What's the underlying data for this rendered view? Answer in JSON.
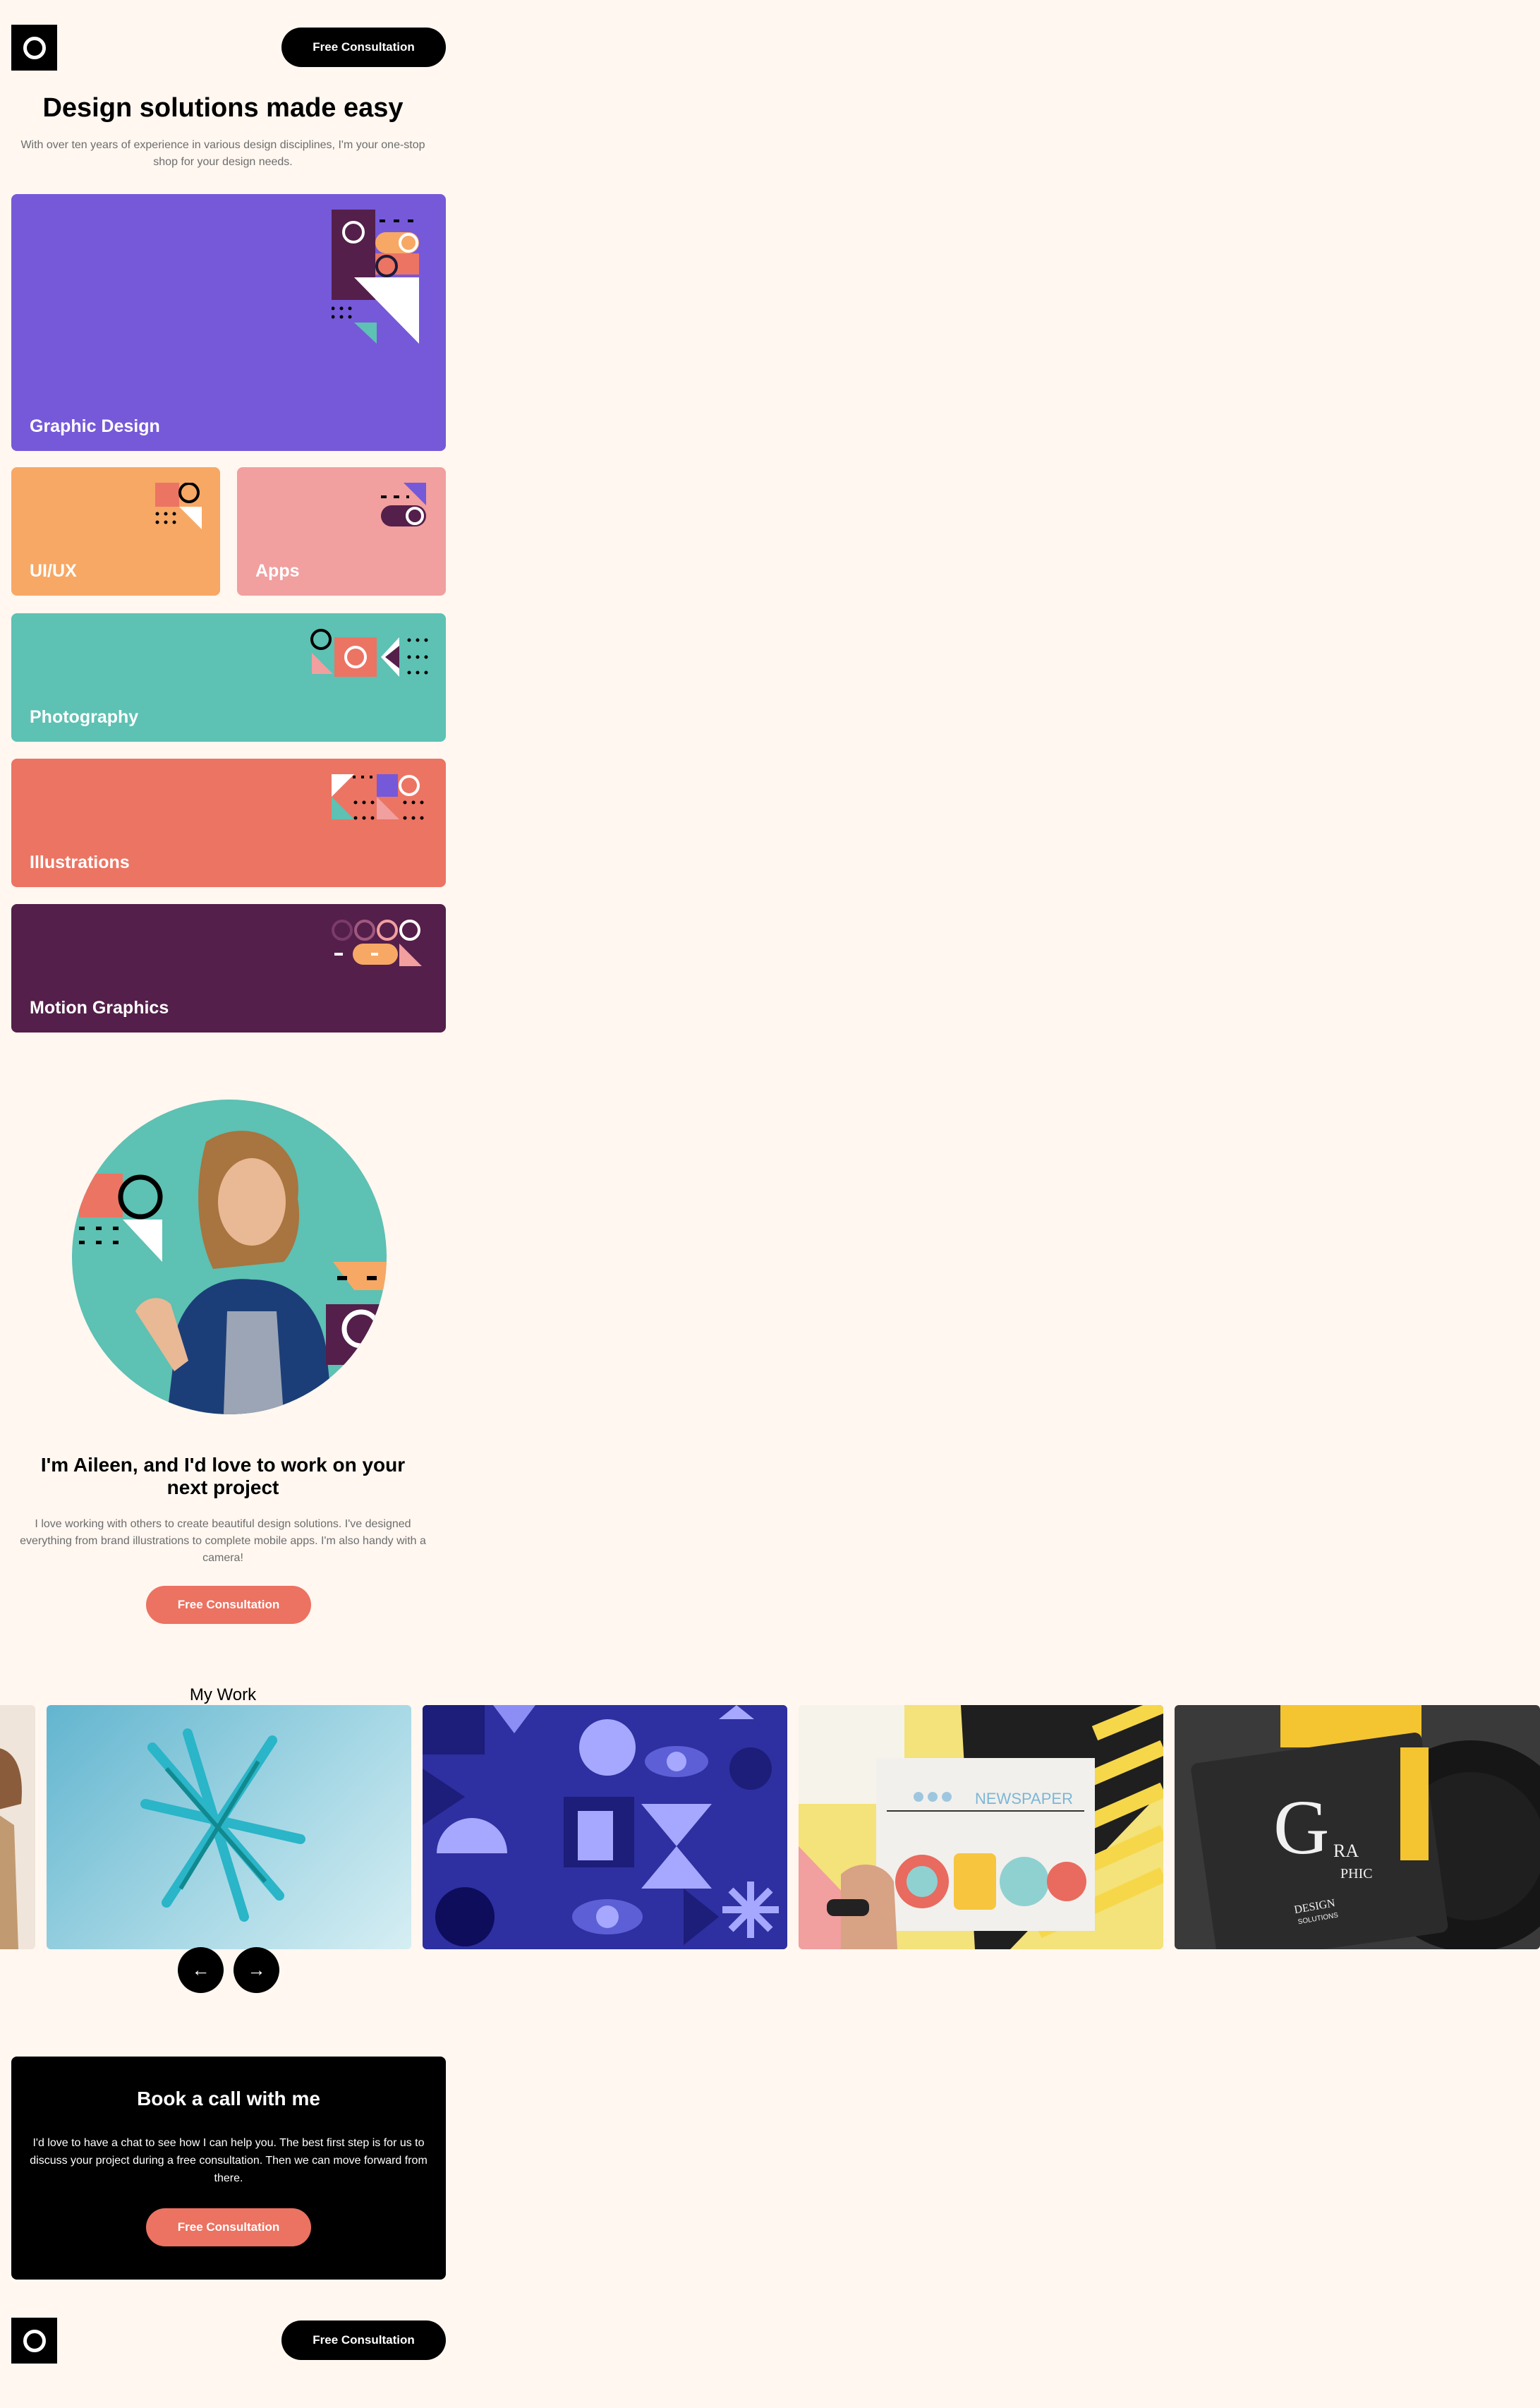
{
  "header": {
    "logo": "circle-logo-icon",
    "cta_label": "Free Consultation"
  },
  "hero": {
    "title": "Design solutions made easy",
    "subtitle": "With over ten years of experience in various design disciplines, I'm your one-stop shop for your design needs."
  },
  "services": [
    {
      "label": "Graphic Design",
      "color": "#7659d9"
    },
    {
      "label": "UI/UX",
      "color": "#f7a865"
    },
    {
      "label": "Apps",
      "color": "#f19f9f"
    },
    {
      "label": "Photography",
      "color": "#5dc1b3"
    },
    {
      "label": "Illustrations",
      "color": "#ec7463"
    },
    {
      "label": "Motion Graphics",
      "color": "#541f4a"
    }
  ],
  "about": {
    "title": "I'm Aileen, and I'd love to work on your next project",
    "body": "I love working with others to create beautiful design solutions. I've designed everything from brand illustrations to complete mobile apps. I'm also handy with a camera!",
    "cta_label": "Free Consultation"
  },
  "work": {
    "title": "My Work",
    "items": [
      {
        "name": "coffee-photo"
      },
      {
        "name": "abstract-sculpture-photo"
      },
      {
        "name": "geometric-pattern-artwork"
      },
      {
        "name": "newspaper-illustration-photo"
      },
      {
        "name": "graphic-design-book-photo",
        "text_lines": [
          "G",
          "RA",
          "PHIC",
          "DESIGN",
          "SOLUTIONS"
        ]
      }
    ],
    "newspaper_title": "NEWSPAPER",
    "prev_icon": "arrow-left-icon",
    "next_icon": "arrow-right-icon"
  },
  "booking": {
    "title": "Book a call with me",
    "body": "I'd love to have a chat to see how I can help you. The best first step is for us to discuss your project during a free consultation. Then we can move forward from there.",
    "cta_label": "Free Consultation"
  },
  "footer": {
    "logo": "circle-logo-icon",
    "cta_label": "Free Consultation"
  },
  "colors": {
    "background": "#fff7f0",
    "accent_coral": "#ec7262",
    "dark_plum": "#541f4a",
    "teal": "#5dc1b3",
    "purple": "#7659d9"
  }
}
